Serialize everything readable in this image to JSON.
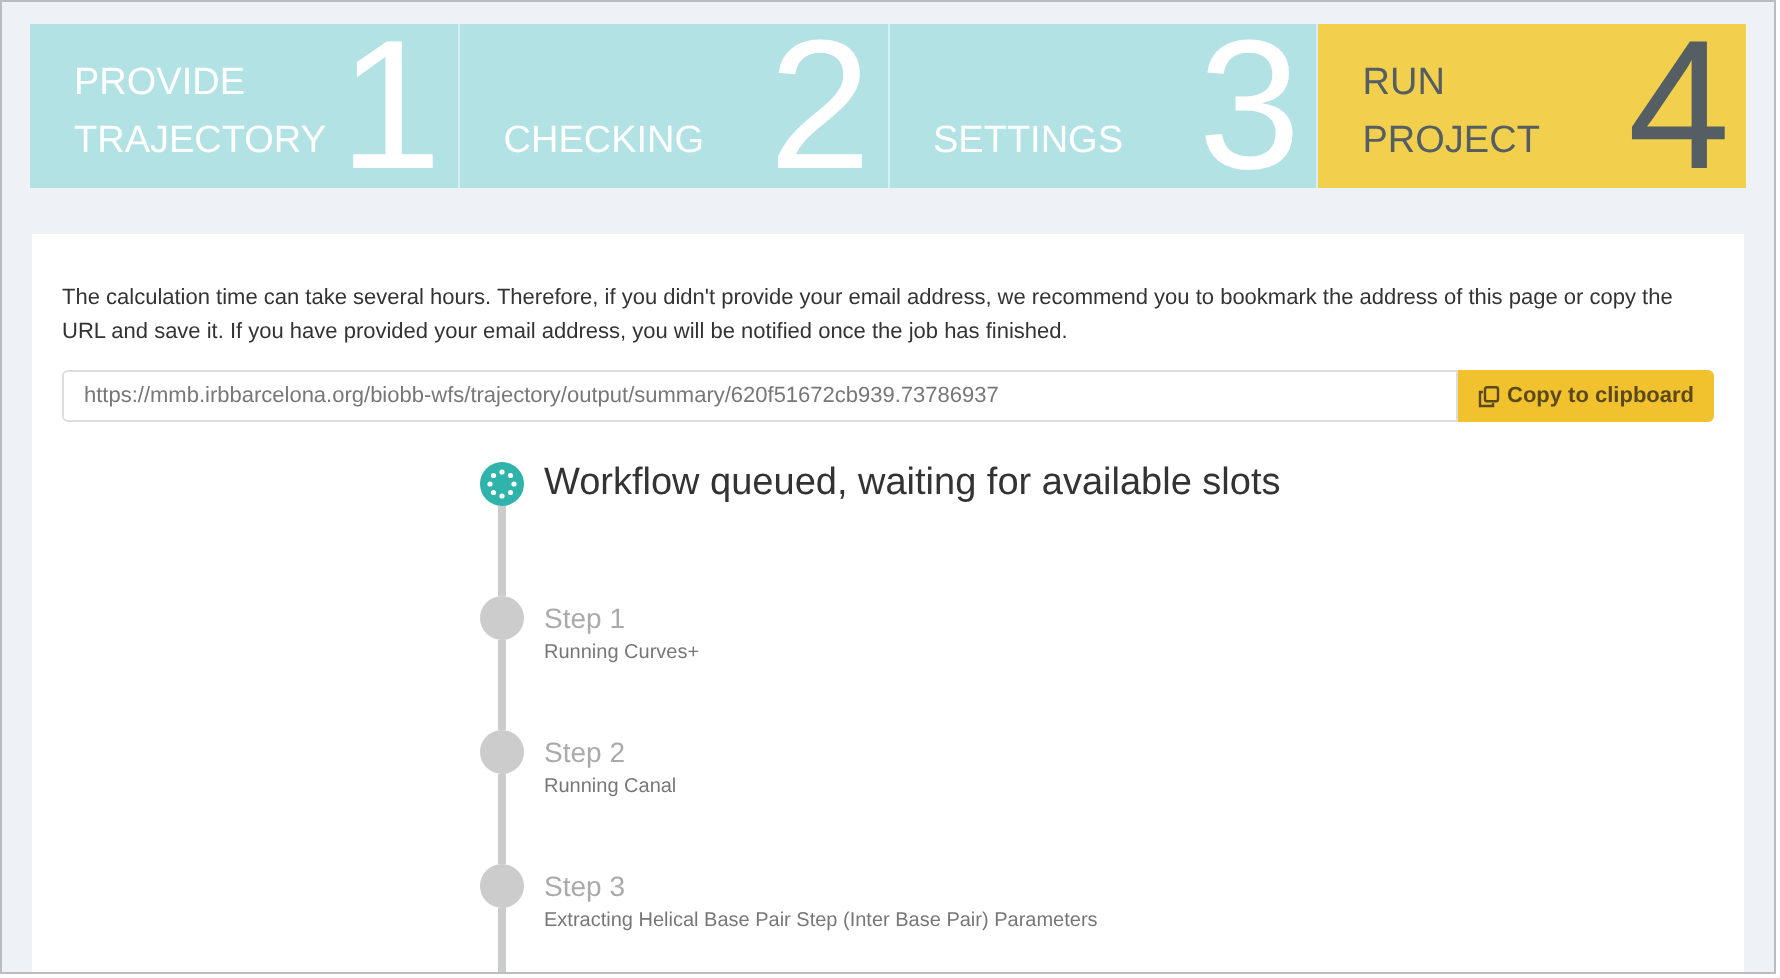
{
  "wizard_steps": [
    {
      "label_lines": [
        "PROVIDE",
        "TRAJECTORY"
      ],
      "number": "1",
      "selected": false
    },
    {
      "label_lines": [
        "CHECKING"
      ],
      "number": "2",
      "selected": false
    },
    {
      "label_lines": [
        "SETTINGS"
      ],
      "number": "3",
      "selected": false
    },
    {
      "label_lines": [
        "RUN",
        "PROJECT"
      ],
      "number": "4",
      "selected": true
    }
  ],
  "notice": "The calculation time can take several hours. Therefore, if you didn't provide your email address, we recommend you to bookmark the address of this page or copy the URL and save it. If you have provided your email address, you will be notified once the job has finished.",
  "url_field": {
    "value": "https://mmb.irbbarcelona.org/biobb-wfs/trajectory/output/summary/620f51672cb939.73786937"
  },
  "copy_button": "Copy to clipboard",
  "timeline": [
    {
      "kind": "current",
      "title": "Workflow queued, waiting for available slots"
    },
    {
      "kind": "pending",
      "title": "Step 1",
      "subtitle": "Running Curves+"
    },
    {
      "kind": "pending",
      "title": "Step 2",
      "subtitle": "Running Canal"
    },
    {
      "kind": "pending",
      "title": "Step 3",
      "subtitle": "Extracting Helical Base Pair Step (Inter Base Pair) Parameters"
    }
  ]
}
